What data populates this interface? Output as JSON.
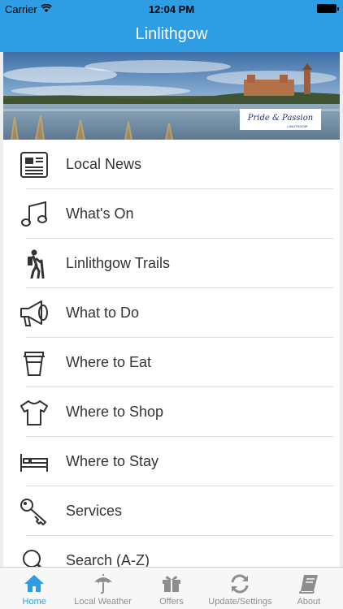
{
  "status_bar": {
    "carrier": "Carrier",
    "time": "12:04 PM"
  },
  "nav": {
    "title": "Linlithgow"
  },
  "banner": {
    "logo_text": "Pride & Passion",
    "logo_subtext": "LINLITHGOW"
  },
  "menu": {
    "items": [
      {
        "label": "Local News",
        "icon": "newspaper-icon"
      },
      {
        "label": "What's On",
        "icon": "music-note-icon"
      },
      {
        "label": "Linlithgow Trails",
        "icon": "hiker-icon"
      },
      {
        "label": "What to Do",
        "icon": "megaphone-icon"
      },
      {
        "label": "Where to Eat",
        "icon": "coffee-cup-icon"
      },
      {
        "label": "Where to Shop",
        "icon": "tshirt-icon"
      },
      {
        "label": "Where to Stay",
        "icon": "bed-icon"
      },
      {
        "label": "Services",
        "icon": "key-icon"
      },
      {
        "label": "Search (A-Z)",
        "icon": "search-icon"
      }
    ]
  },
  "tabs": [
    {
      "label": "Home",
      "icon": "home-icon",
      "active": true
    },
    {
      "label": "Local Weather",
      "icon": "umbrella-icon",
      "active": false
    },
    {
      "label": "Offers",
      "icon": "gift-icon",
      "active": false
    },
    {
      "label": "Update/Settings",
      "icon": "refresh-icon",
      "active": false
    },
    {
      "label": "About",
      "icon": "book-icon",
      "active": false
    }
  ],
  "colors": {
    "accent": "#2f9de4",
    "tab_inactive": "#8e8e8e",
    "text": "#333333"
  }
}
